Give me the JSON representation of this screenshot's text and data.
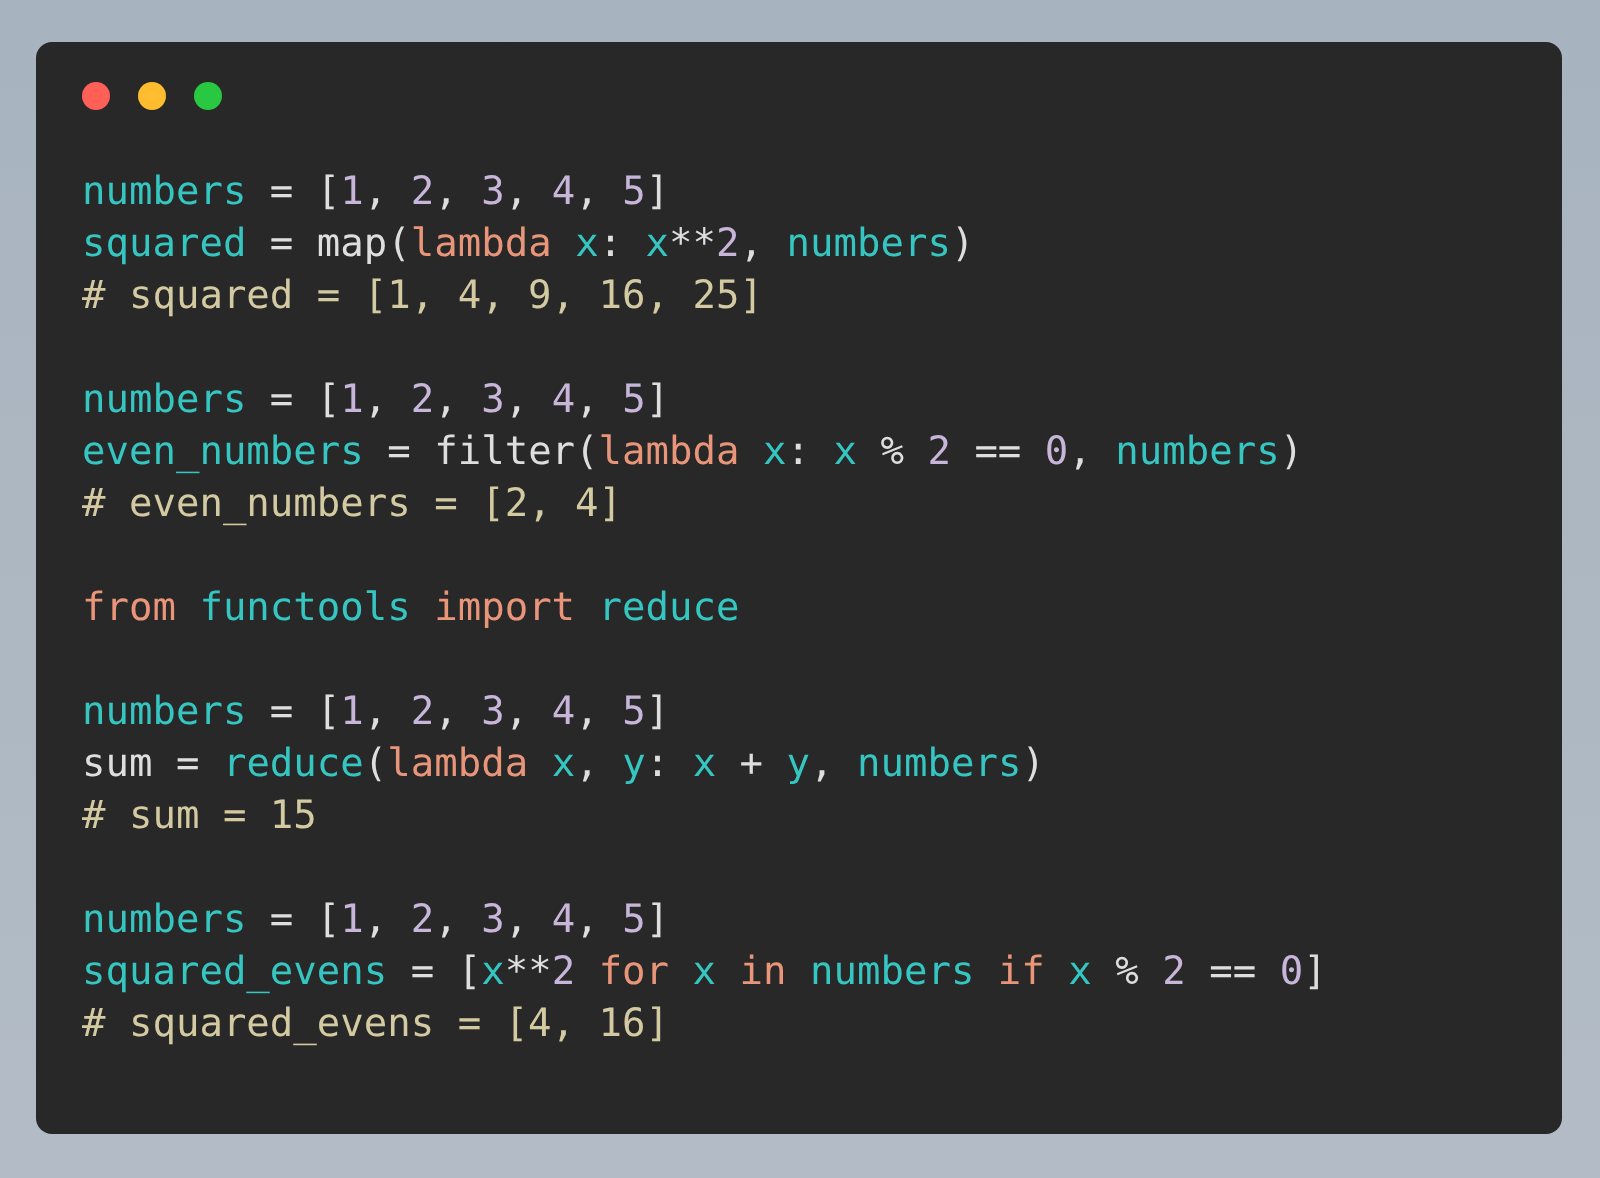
{
  "window": {
    "controls": [
      {
        "kind": "close"
      },
      {
        "kind": "minimize"
      },
      {
        "kind": "maximize"
      }
    ]
  },
  "code": {
    "blocks": [
      {
        "lines": [
          {
            "tokens": [
              {
                "kind": "var",
                "text": "numbers"
              },
              {
                "kind": "plain",
                "text": " = ["
              },
              {
                "kind": "num",
                "text": "1"
              },
              {
                "kind": "plain",
                "text": ", "
              },
              {
                "kind": "num",
                "text": "2"
              },
              {
                "kind": "plain",
                "text": ", "
              },
              {
                "kind": "num",
                "text": "3"
              },
              {
                "kind": "plain",
                "text": ", "
              },
              {
                "kind": "num",
                "text": "4"
              },
              {
                "kind": "plain",
                "text": ", "
              },
              {
                "kind": "num",
                "text": "5"
              },
              {
                "kind": "plain",
                "text": "]"
              }
            ]
          },
          {
            "tokens": [
              {
                "kind": "var",
                "text": "squared"
              },
              {
                "kind": "plain",
                "text": " = map("
              },
              {
                "kind": "kw",
                "text": "lambda "
              },
              {
                "kind": "var",
                "text": "x"
              },
              {
                "kind": "plain",
                "text": ": "
              },
              {
                "kind": "var",
                "text": "x"
              },
              {
                "kind": "plain",
                "text": "**"
              },
              {
                "kind": "num",
                "text": "2"
              },
              {
                "kind": "plain",
                "text": ", "
              },
              {
                "kind": "var",
                "text": "numbers"
              },
              {
                "kind": "plain",
                "text": ")"
              }
            ]
          },
          {
            "tokens": [
              {
                "kind": "comment",
                "text": "# squared = [1, 4, 9, 16, 25]"
              }
            ]
          }
        ]
      },
      {
        "lines": [
          {
            "tokens": [
              {
                "kind": "var",
                "text": "numbers"
              },
              {
                "kind": "plain",
                "text": " = ["
              },
              {
                "kind": "num",
                "text": "1"
              },
              {
                "kind": "plain",
                "text": ", "
              },
              {
                "kind": "num",
                "text": "2"
              },
              {
                "kind": "plain",
                "text": ", "
              },
              {
                "kind": "num",
                "text": "3"
              },
              {
                "kind": "plain",
                "text": ", "
              },
              {
                "kind": "num",
                "text": "4"
              },
              {
                "kind": "plain",
                "text": ", "
              },
              {
                "kind": "num",
                "text": "5"
              },
              {
                "kind": "plain",
                "text": "]"
              }
            ]
          },
          {
            "tokens": [
              {
                "kind": "var",
                "text": "even_numbers"
              },
              {
                "kind": "plain",
                "text": " = filter("
              },
              {
                "kind": "kw",
                "text": "lambda "
              },
              {
                "kind": "var",
                "text": "x"
              },
              {
                "kind": "plain",
                "text": ": "
              },
              {
                "kind": "var",
                "text": "x"
              },
              {
                "kind": "plain",
                "text": " % "
              },
              {
                "kind": "num",
                "text": "2"
              },
              {
                "kind": "plain",
                "text": " == "
              },
              {
                "kind": "num",
                "text": "0"
              },
              {
                "kind": "plain",
                "text": ", "
              },
              {
                "kind": "var",
                "text": "numbers"
              },
              {
                "kind": "plain",
                "text": ")"
              }
            ]
          },
          {
            "tokens": [
              {
                "kind": "comment",
                "text": "# even_numbers = [2, 4]"
              }
            ]
          }
        ]
      },
      {
        "lines": [
          {
            "tokens": [
              {
                "kind": "kw",
                "text": "from "
              },
              {
                "kind": "var",
                "text": "functools "
              },
              {
                "kind": "kw",
                "text": "import "
              },
              {
                "kind": "var",
                "text": "reduce"
              }
            ]
          }
        ]
      },
      {
        "lines": [
          {
            "tokens": [
              {
                "kind": "var",
                "text": "numbers"
              },
              {
                "kind": "plain",
                "text": " = ["
              },
              {
                "kind": "num",
                "text": "1"
              },
              {
                "kind": "plain",
                "text": ", "
              },
              {
                "kind": "num",
                "text": "2"
              },
              {
                "kind": "plain",
                "text": ", "
              },
              {
                "kind": "num",
                "text": "3"
              },
              {
                "kind": "plain",
                "text": ", "
              },
              {
                "kind": "num",
                "text": "4"
              },
              {
                "kind": "plain",
                "text": ", "
              },
              {
                "kind": "num",
                "text": "5"
              },
              {
                "kind": "plain",
                "text": "]"
              }
            ]
          },
          {
            "tokens": [
              {
                "kind": "plain",
                "text": "sum = "
              },
              {
                "kind": "var",
                "text": "reduce"
              },
              {
                "kind": "plain",
                "text": "("
              },
              {
                "kind": "kw",
                "text": "lambda "
              },
              {
                "kind": "var",
                "text": "x"
              },
              {
                "kind": "plain",
                "text": ", "
              },
              {
                "kind": "var",
                "text": "y"
              },
              {
                "kind": "plain",
                "text": ": "
              },
              {
                "kind": "var",
                "text": "x"
              },
              {
                "kind": "plain",
                "text": " + "
              },
              {
                "kind": "var",
                "text": "y"
              },
              {
                "kind": "plain",
                "text": ", "
              },
              {
                "kind": "var",
                "text": "numbers"
              },
              {
                "kind": "plain",
                "text": ")"
              }
            ]
          },
          {
            "tokens": [
              {
                "kind": "comment",
                "text": "# sum = 15"
              }
            ]
          }
        ]
      },
      {
        "lines": [
          {
            "tokens": [
              {
                "kind": "var",
                "text": "numbers"
              },
              {
                "kind": "plain",
                "text": " = ["
              },
              {
                "kind": "num",
                "text": "1"
              },
              {
                "kind": "plain",
                "text": ", "
              },
              {
                "kind": "num",
                "text": "2"
              },
              {
                "kind": "plain",
                "text": ", "
              },
              {
                "kind": "num",
                "text": "3"
              },
              {
                "kind": "plain",
                "text": ", "
              },
              {
                "kind": "num",
                "text": "4"
              },
              {
                "kind": "plain",
                "text": ", "
              },
              {
                "kind": "num",
                "text": "5"
              },
              {
                "kind": "plain",
                "text": "]"
              }
            ]
          },
          {
            "tokens": [
              {
                "kind": "var",
                "text": "squared_evens"
              },
              {
                "kind": "plain",
                "text": " = ["
              },
              {
                "kind": "var",
                "text": "x"
              },
              {
                "kind": "plain",
                "text": "**"
              },
              {
                "kind": "num",
                "text": "2"
              },
              {
                "kind": "kw",
                "text": " for "
              },
              {
                "kind": "var",
                "text": "x"
              },
              {
                "kind": "kw",
                "text": " in "
              },
              {
                "kind": "var",
                "text": "numbers"
              },
              {
                "kind": "kw",
                "text": " if "
              },
              {
                "kind": "var",
                "text": "x"
              },
              {
                "kind": "plain",
                "text": " % "
              },
              {
                "kind": "num",
                "text": "2"
              },
              {
                "kind": "plain",
                "text": " == "
              },
              {
                "kind": "num",
                "text": "0"
              },
              {
                "kind": "plain",
                "text": "]"
              }
            ]
          },
          {
            "tokens": [
              {
                "kind": "comment",
                "text": "# squared_evens = [4, 16]"
              }
            ]
          }
        ]
      }
    ]
  }
}
